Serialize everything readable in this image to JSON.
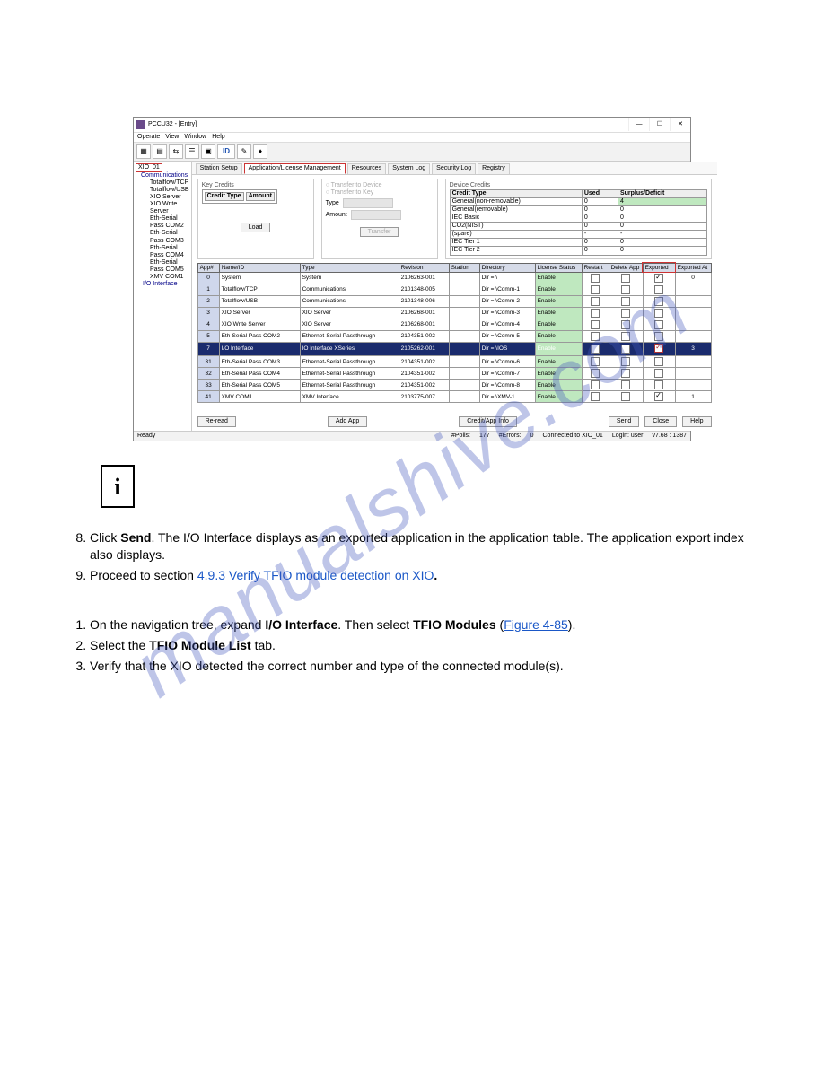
{
  "app": {
    "title": "PCCU32 - [Entry]",
    "menus": [
      "Operate",
      "View",
      "Window",
      "Help"
    ],
    "winbtns": {
      "min": "—",
      "max": "☐",
      "close": "✕"
    },
    "toolbar_id": "ID"
  },
  "tree": {
    "root": "XIO_01",
    "comm_label": "Communications",
    "items": [
      "Totalflow/TCP",
      "Totalflow/USB",
      "XIO Server",
      "XIO Write Server",
      "Eth-Serial Pass COM2",
      "Eth-Serial Pass COM3",
      "Eth-Serial Pass COM4",
      "Eth-Serial Pass COM5",
      "XMV COM1"
    ],
    "io_label": "I/O Interface"
  },
  "tabs": [
    "Station Setup",
    "Application/License Management",
    "Resources",
    "System Log",
    "Security Log",
    "Registry"
  ],
  "active_tab": 1,
  "key_credits": {
    "title": "Key Credits",
    "cols": [
      "Credit Type",
      "Amount"
    ],
    "load_btn": "Load"
  },
  "transfer": {
    "title_device": "Transfer to Device",
    "title_key": "Transfer to Key",
    "type_label": "Type",
    "amount_label": "Amount",
    "btn": "Transfer"
  },
  "device_credits": {
    "title": "Device Credits",
    "cols": [
      "Credit Type",
      "Used",
      "Surplus/Deficit"
    ],
    "rows": [
      {
        "t": "General(non-removable)",
        "u": "0",
        "s": "4",
        "sbg": "#bfe8bf"
      },
      {
        "t": "General(removable)",
        "u": "0",
        "s": "0"
      },
      {
        "t": "IEC Basic",
        "u": "0",
        "s": "0"
      },
      {
        "t": "CO2(NIST)",
        "u": "0",
        "s": "0"
      },
      {
        "t": "(spare)",
        "u": "-",
        "s": "-"
      },
      {
        "t": "IEC Tier 1",
        "u": "0",
        "s": "0"
      },
      {
        "t": "IEC Tier 2",
        "u": "0",
        "s": "0"
      }
    ]
  },
  "apptable": {
    "headers": [
      "App#",
      "Name/ID",
      "Type",
      "Revision",
      "Station",
      "Directory",
      "License Status",
      "Restart",
      "Delete App",
      "Exported",
      "Exported At"
    ],
    "rows": [
      {
        "n": "0",
        "name": "System",
        "type": "System",
        "rev": "2106263-001",
        "dir": "Dir = \\",
        "ls": "Enable",
        "restart": "cb",
        "del": "cb",
        "exp": "cbx",
        "at": "0"
      },
      {
        "n": "1",
        "name": "Totalflow/TCP",
        "type": "Communications",
        "rev": "2101348-005",
        "dir": "Dir = \\Comm-1",
        "ls": "Enable",
        "restart": "cb",
        "del": "cb",
        "exp": "cb",
        "at": ""
      },
      {
        "n": "2",
        "name": "Totalflow/USB",
        "type": "Communications",
        "rev": "2101348-006",
        "dir": "Dir = \\Comm-2",
        "ls": "Enable",
        "restart": "cb",
        "del": "cb",
        "exp": "cb",
        "at": ""
      },
      {
        "n": "3",
        "name": "XIO Server",
        "type": "XIO Server",
        "rev": "2106268-001",
        "dir": "Dir = \\Comm-3",
        "ls": "Enable",
        "restart": "cb",
        "del": "cb",
        "exp": "cb",
        "at": ""
      },
      {
        "n": "4",
        "name": "XIO Write Server",
        "type": "XIO Server",
        "rev": "2106268-001",
        "dir": "Dir = \\Comm-4",
        "ls": "Enable",
        "restart": "cb",
        "del": "cb",
        "exp": "cb",
        "at": ""
      },
      {
        "n": "5",
        "name": "Eth-Serial Pass COM2",
        "type": "Ethernet-Serial Passthrough",
        "rev": "2104351-002",
        "dir": "Dir = \\Comm-5",
        "ls": "Enable",
        "restart": "cb",
        "del": "cb",
        "exp": "cb",
        "at": ""
      },
      {
        "n": "7",
        "name": "I/O Interface",
        "type": "IO Interface XSeries",
        "rev": "2105262-001",
        "dir": "Dir = \\IOS",
        "ls": "Enable",
        "restart": "cb",
        "del": "cb",
        "exp": "cbxr",
        "at": "3",
        "sel": true
      },
      {
        "n": "31",
        "name": "Eth-Serial Pass COM3",
        "type": "Ethernet-Serial Passthrough",
        "rev": "2104351-002",
        "dir": "Dir = \\Comm-6",
        "ls": "Enable",
        "restart": "cb",
        "del": "cb",
        "exp": "cb",
        "at": ""
      },
      {
        "n": "32",
        "name": "Eth-Serial Pass COM4",
        "type": "Ethernet-Serial Passthrough",
        "rev": "2104351-002",
        "dir": "Dir = \\Comm-7",
        "ls": "Enable",
        "restart": "cb",
        "del": "cb",
        "exp": "cb",
        "at": ""
      },
      {
        "n": "33",
        "name": "Eth-Serial Pass COM5",
        "type": "Ethernet-Serial Passthrough",
        "rev": "2104351-002",
        "dir": "Dir = \\Comm-8",
        "ls": "Enable",
        "restart": "cb",
        "del": "cb",
        "exp": "cb",
        "at": ""
      },
      {
        "n": "41",
        "name": "XMV COM1",
        "type": "XMV Interface",
        "rev": "2103775-007",
        "dir": "Dir = \\XMV-1",
        "ls": "Enable",
        "restart": "cb",
        "del": "cb",
        "exp": "cbx",
        "at": "1"
      }
    ]
  },
  "buttons": {
    "reread": "Re-read",
    "addapp": "Add App",
    "credit": "Credit/App Info",
    "send": "Send",
    "close": "Close",
    "help": "Help"
  },
  "status": {
    "ready": "Ready",
    "polls": "#Polls:",
    "polls_n": "177",
    "errors": "#Errors:",
    "errors_n": "0",
    "conn": "Connected to XIO_01",
    "login": "Login: user",
    "ver": "v7.68 : 1387"
  },
  "watermark": "manualshive.com",
  "instructions": {
    "i_symbol": "i",
    "step8_a": "Click ",
    "step8_b": "Send",
    "step8_c": ". The I/O Interface displays as an exported application in the application table. The application export index also displays.",
    "step9_a": "Proceed to section ",
    "step9_link1": "4.9.3",
    "step9_space": " ",
    "step9_link2": "Verify TFIO module detection on XIO",
    "step9_d": ".",
    "b1_a": "On the navigation tree, expand ",
    "b1_b": "I/O Interface",
    "b1_c": ". Then select ",
    "b1_d": "TFIO Modules",
    "b1_e": " (",
    "b1_link": "Figure 4-85",
    "b1_f": ").",
    "b2_a": "Select the ",
    "b2_b": "TFIO Module List",
    "b2_c": " tab.",
    "b3": "Verify that the XIO detected the correct number and type of the connected module(s)."
  }
}
